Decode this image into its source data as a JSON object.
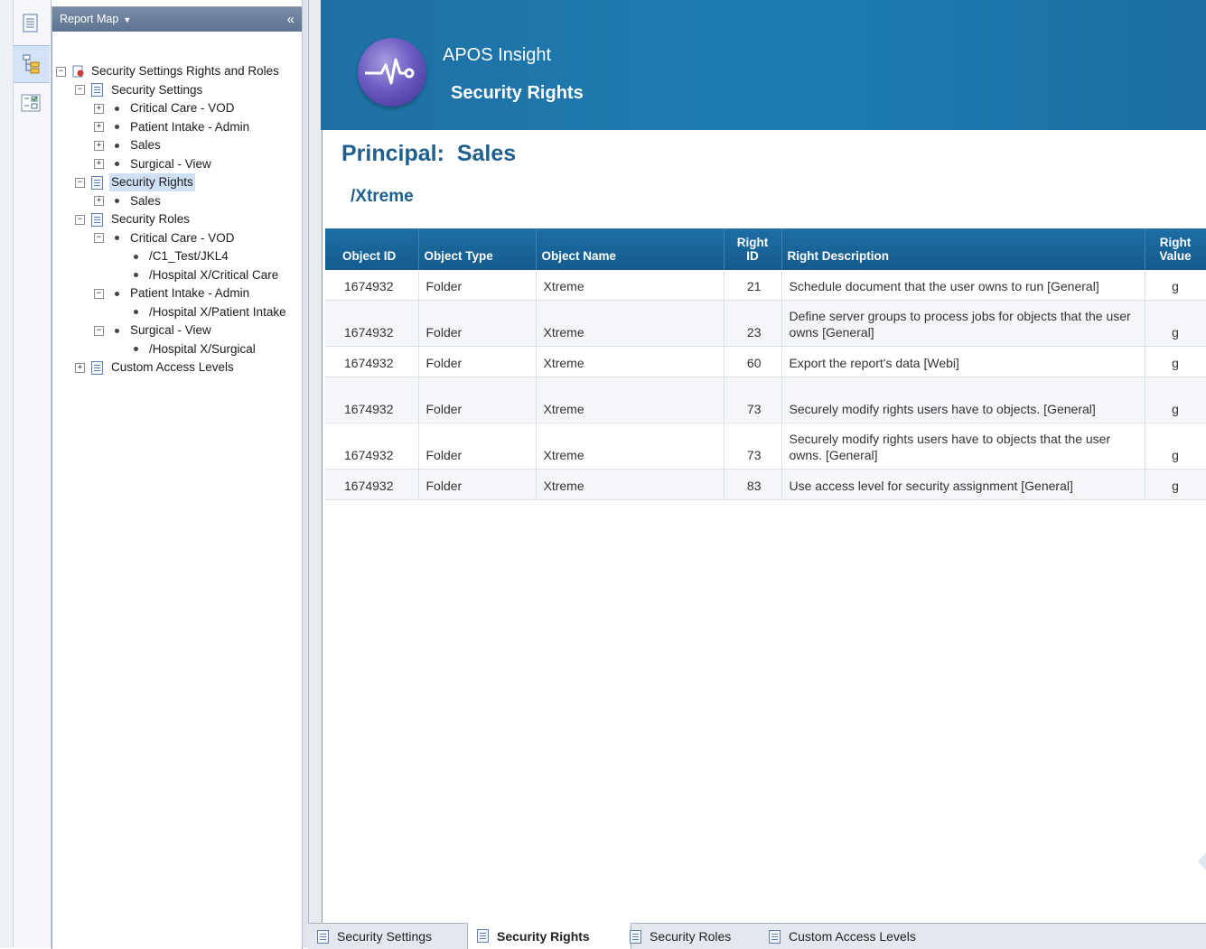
{
  "report_map": {
    "title": "Report Map",
    "collapse_label": "«",
    "tree": [
      {
        "label": "Security Settings Rights and Roles",
        "exp": "−",
        "icon": "report-root-icon"
      },
      {
        "label": "Security Settings",
        "exp": "−",
        "icon": "report-section-icon"
      },
      {
        "label": "Critical Care - VOD",
        "exp": "+",
        "icon": "bullet-icon"
      },
      {
        "label": "Patient Intake - Admin",
        "exp": "+",
        "icon": "bullet-icon"
      },
      {
        "label": "Sales",
        "exp": "+",
        "icon": "bullet-icon"
      },
      {
        "label": "Surgical - View",
        "exp": "+",
        "icon": "bullet-icon"
      },
      {
        "label": "Security Rights",
        "exp": "−",
        "icon": "report-section-icon"
      },
      {
        "label": "Sales",
        "exp": "+",
        "icon": "bullet-icon"
      },
      {
        "label": "Security Roles",
        "exp": "−",
        "icon": "report-section-icon"
      },
      {
        "label": "Critical Care - VOD",
        "exp": "−",
        "icon": "bullet-icon"
      },
      {
        "label": "/C1_Test/JKL4",
        "exp": "",
        "icon": "bullet-icon"
      },
      {
        "label": "/Hospital X/Critical Care",
        "exp": "",
        "icon": "bullet-icon"
      },
      {
        "label": "Patient Intake - Admin",
        "exp": "−",
        "icon": "bullet-icon"
      },
      {
        "label": "/Hospital X/Patient Intake",
        "exp": "",
        "icon": "bullet-icon"
      },
      {
        "label": "Surgical - View",
        "exp": "−",
        "icon": "bullet-icon"
      },
      {
        "label": "/Hospital X/Surgical",
        "exp": "",
        "icon": "bullet-icon"
      },
      {
        "label": "Custom Access Levels",
        "exp": "+",
        "icon": "report-section-icon"
      }
    ]
  },
  "banner": {
    "app_name": "APOS Insight",
    "report_title": "Security Rights"
  },
  "principal": {
    "label": "Principal:",
    "name": "Sales"
  },
  "path": "/Xtreme",
  "table": {
    "columns": [
      "Object ID",
      "Object Type",
      "Object Name",
      "Right ID",
      "Right Description",
      "Right Value"
    ],
    "rows": [
      {
        "object_id": "1674932",
        "object_type": "Folder",
        "object_name": "Xtreme",
        "right_id": "21",
        "description": "Schedule document that the user owns to run [General]",
        "value": "g"
      },
      {
        "object_id": "1674932",
        "object_type": "Folder",
        "object_name": "Xtreme",
        "right_id": "23",
        "description": "Define server groups to process jobs for objects that the user owns [General]",
        "value": "g"
      },
      {
        "object_id": "1674932",
        "object_type": "Folder",
        "object_name": "Xtreme",
        "right_id": "60",
        "description": "Export the report's data [Webi]",
        "value": "g"
      },
      {
        "object_id": "1674932",
        "object_type": "Folder",
        "object_name": "Xtreme",
        "right_id": "73",
        "description": "Securely modify rights users have to objects. [General]",
        "value": "g"
      },
      {
        "object_id": "1674932",
        "object_type": "Folder",
        "object_name": "Xtreme",
        "right_id": "73",
        "description": "Securely modify rights users have to objects that the user owns. [General]",
        "value": "g"
      },
      {
        "object_id": "1674932",
        "object_type": "Folder",
        "object_name": "Xtreme",
        "right_id": "83",
        "description": "Use access level for security assignment [General]",
        "value": "g"
      }
    ]
  },
  "tabs": [
    {
      "label": "Security Settings",
      "active": false
    },
    {
      "label": "Security Rights",
      "active": true
    },
    {
      "label": "Security Roles",
      "active": false
    },
    {
      "label": "Custom Access Levels",
      "active": false
    }
  ],
  "rail": [
    "document-icon",
    "report-map-icon",
    "input-controls-icon"
  ],
  "colors": {
    "banner": "#1d78ad",
    "heading": "#1e5f8f",
    "selection": "#cfe0f4"
  }
}
